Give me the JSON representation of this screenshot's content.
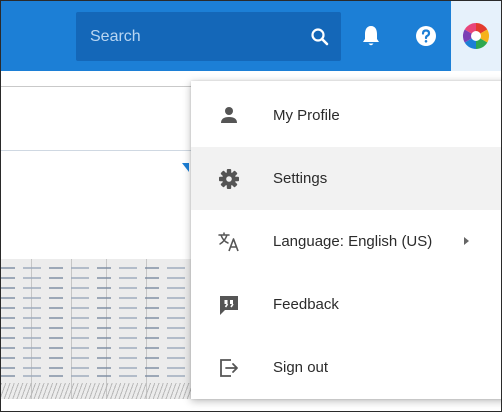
{
  "header": {
    "search": {
      "placeholder": "Search",
      "value": ""
    },
    "icons": [
      "search-icon",
      "bell-icon",
      "help-icon",
      "app-logo"
    ],
    "colors": {
      "topbar": "#1c7fd6",
      "search_box": "#1467b8",
      "avatar_slot": "#e6f1fb"
    }
  },
  "menu": {
    "items": [
      {
        "label": "My Profile",
        "icon": "person-icon"
      },
      {
        "label": "Settings",
        "icon": "gear-icon",
        "highlighted": true
      },
      {
        "label": "Language: English (US)",
        "icon": "translate-icon",
        "submenu": true
      },
      {
        "label": "Feedback",
        "icon": "feedback-icon"
      },
      {
        "label": "Sign out",
        "icon": "sign-out-icon"
      }
    ]
  }
}
